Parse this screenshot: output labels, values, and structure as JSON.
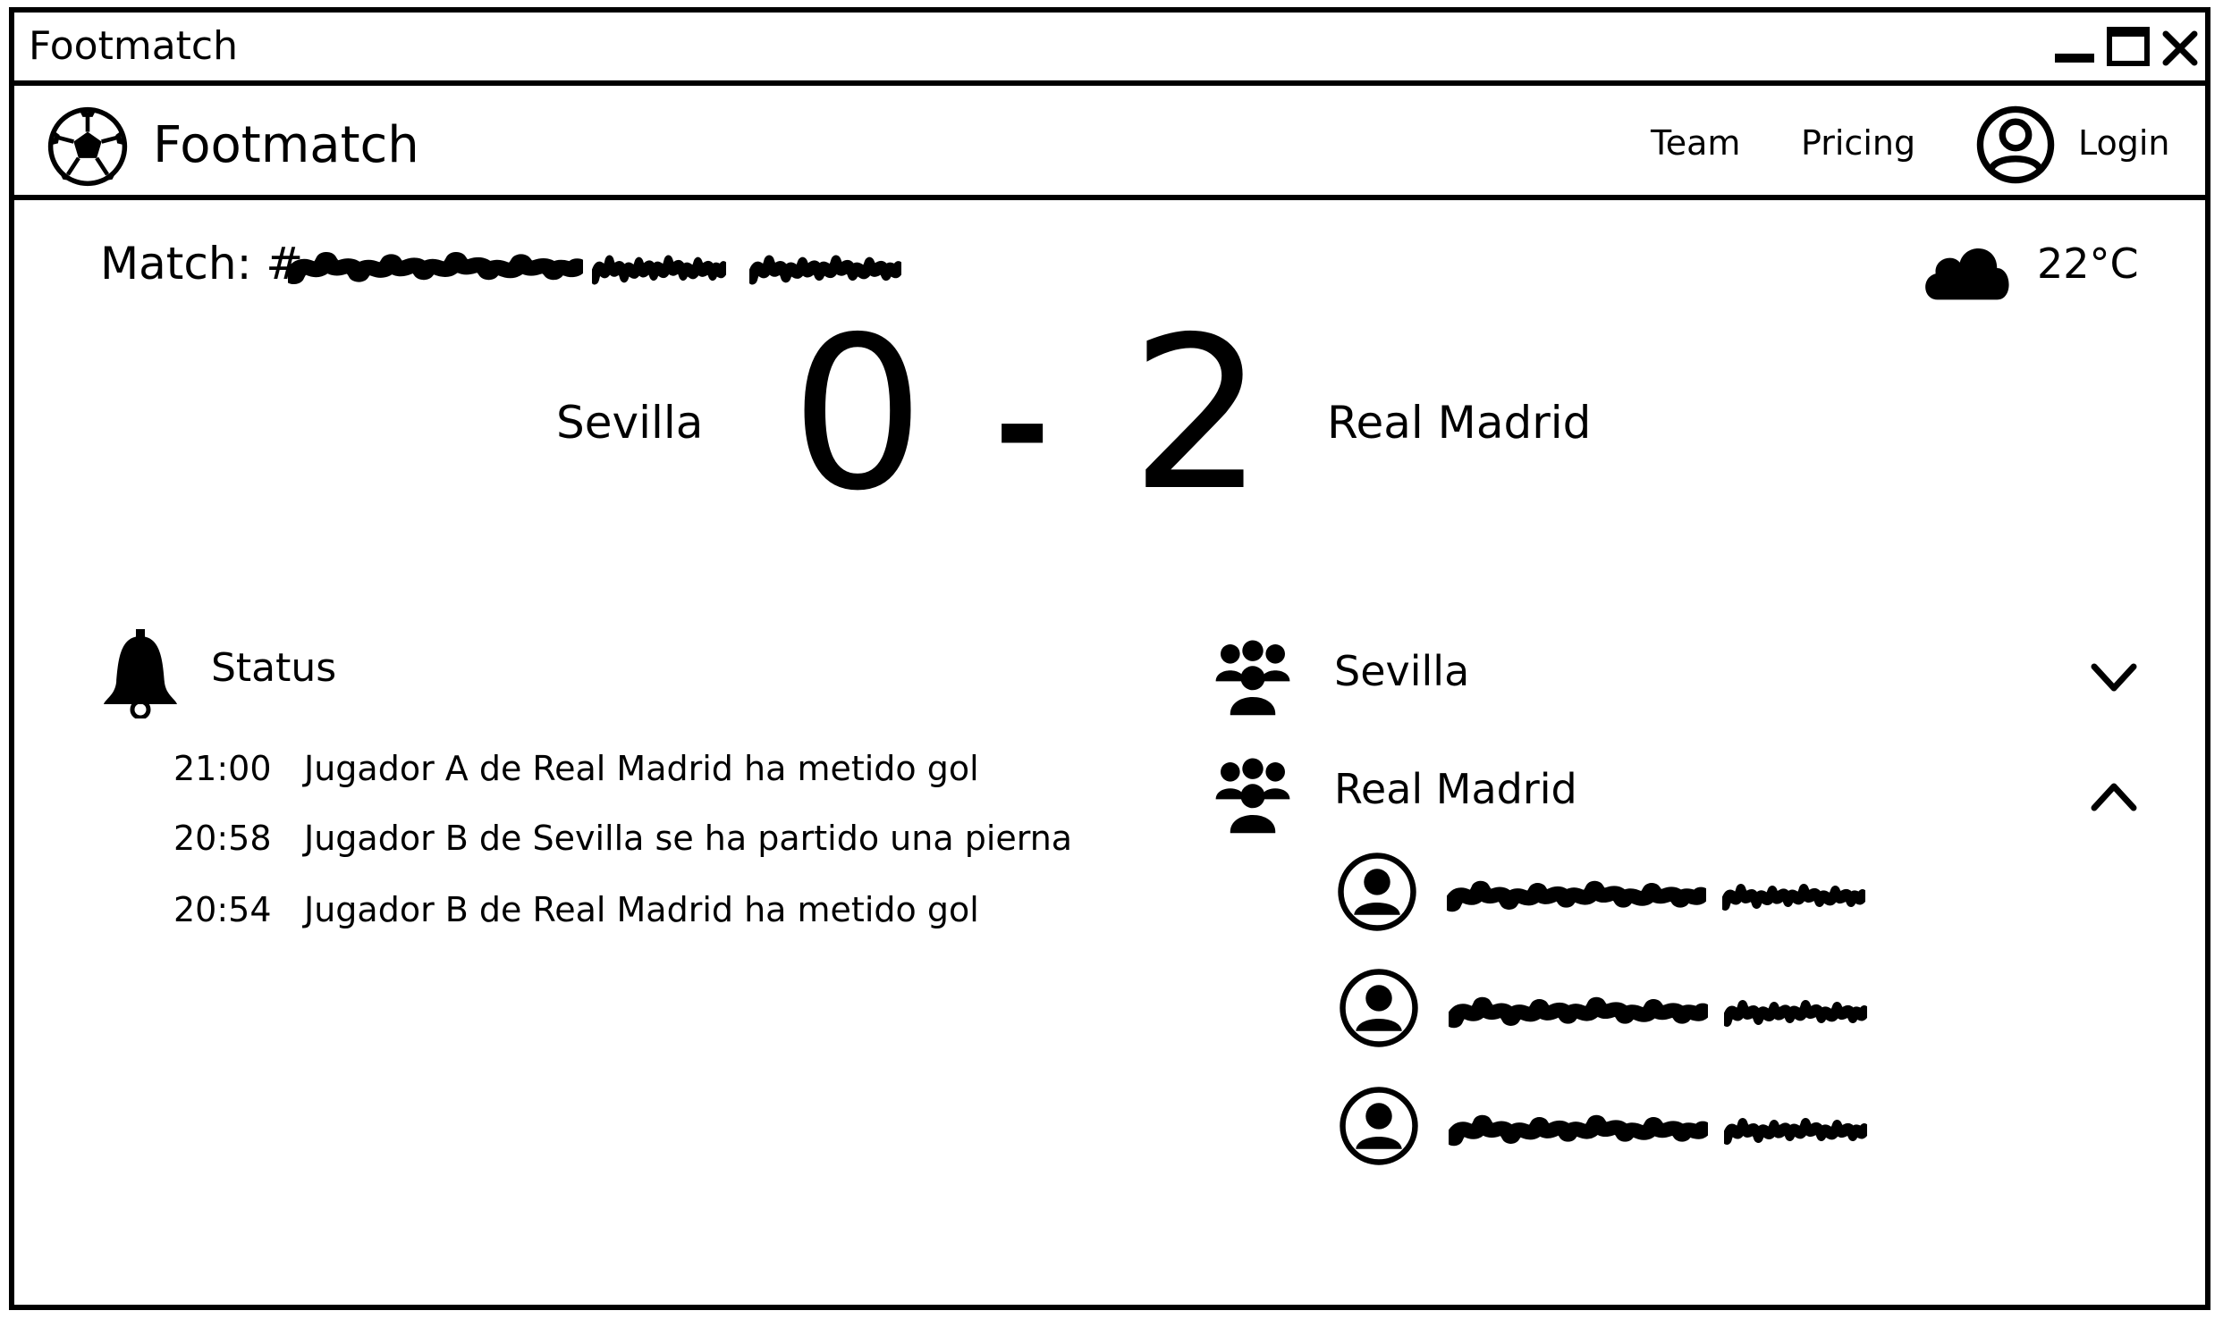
{
  "window": {
    "title": "Footmatch",
    "controls": [
      "minimize-icon",
      "maximize-icon",
      "close-icon"
    ]
  },
  "navbar": {
    "brand": "Footmatch",
    "brand_icon": "soccer-ball-icon",
    "links": [
      {
        "label": "Team"
      },
      {
        "label": "Pricing"
      }
    ],
    "login_label": "Login",
    "login_icon": "user-avatar-icon"
  },
  "match": {
    "label": "Match: #",
    "id_redacted": true,
    "weather_icon": "cloud-icon",
    "temperature": "22°C",
    "home_team": "Sevilla",
    "away_team": "Real Madrid",
    "home_score": "0",
    "separator": "-",
    "away_score": "2"
  },
  "status": {
    "heading": "Status",
    "icon": "bell-icon",
    "events": [
      {
        "time": "21:00",
        "text": "Jugador A de Real Madrid ha metido gol"
      },
      {
        "time": "20:58",
        "text": "Jugador B de Sevilla se ha partido una pierna"
      },
      {
        "time": "20:54",
        "text": "Jugador B de Real Madrid ha metido gol"
      }
    ]
  },
  "teams": [
    {
      "name": "Sevilla",
      "icon": "team-group-icon",
      "expanded": false,
      "toggle_icon": "chevron-down-icon"
    },
    {
      "name": "Real Madrid",
      "icon": "team-group-icon",
      "expanded": true,
      "toggle_icon": "chevron-up-icon",
      "players_shown": 3,
      "player_names_redacted": true
    }
  ]
}
